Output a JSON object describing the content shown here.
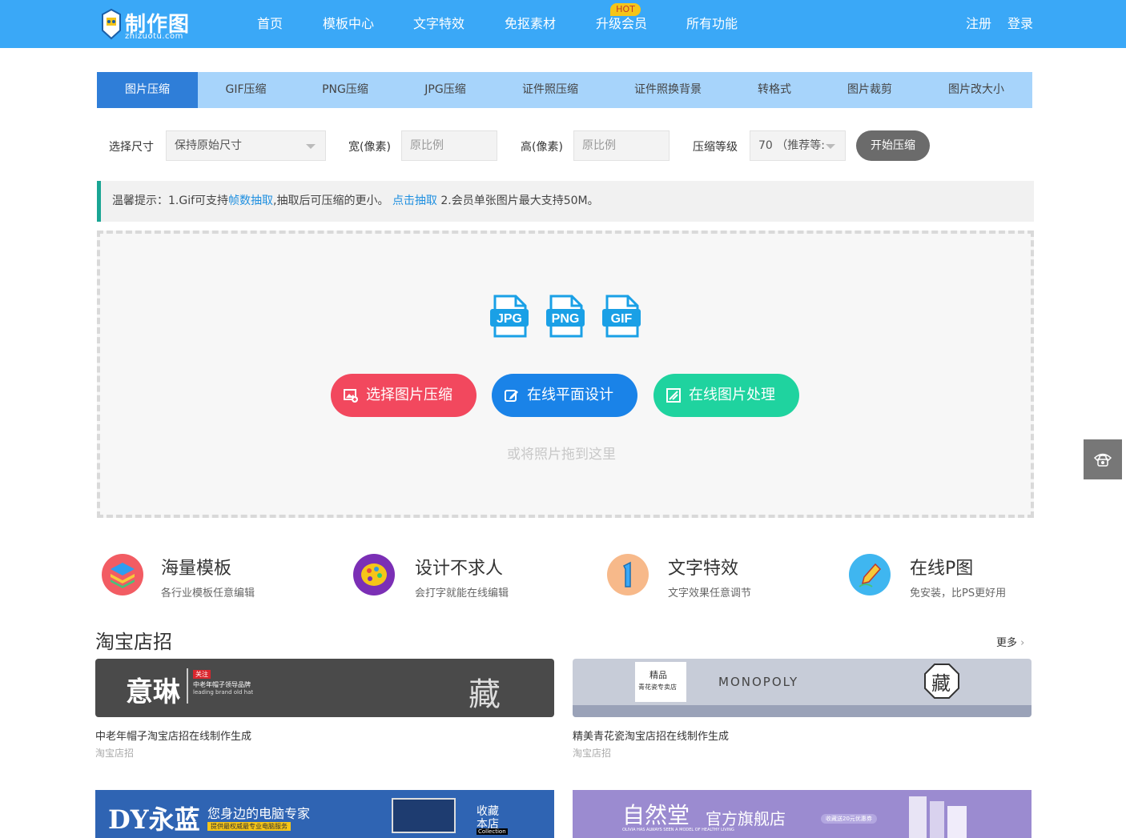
{
  "header": {
    "logo_text": "制作图",
    "logo_sub": "zhizuotu.com",
    "nav": [
      "首页",
      "模板中心",
      "文字特效",
      "免抠素材",
      "升级会员",
      "所有功能"
    ],
    "hot_badge": "HOT",
    "register": "注册",
    "login": "登录"
  },
  "tabs": [
    "图片压缩",
    "GIF压缩",
    "PNG压缩",
    "JPG压缩",
    "证件照压缩",
    "证件照换背景",
    "转格式",
    "图片裁剪",
    "图片改大小"
  ],
  "controls": {
    "size_label": "选择尺寸",
    "size_value": "保持原始尺寸",
    "width_label": "宽(像素)",
    "width_placeholder": "原比例",
    "height_label": "高(像素)",
    "height_placeholder": "原比例",
    "level_label": "压缩等级",
    "level_value": "70 （推荐等:",
    "start_button": "开始压缩"
  },
  "tip": {
    "prefix": "温馨提示：1.Gif可支持",
    "link1": "帧数抽取",
    "middle": ",抽取后可压缩的更小。 ",
    "link2": "点击抽取",
    "suffix": " 2.会员单张图片最大支持50M。"
  },
  "drop": {
    "file_types": [
      "JPG",
      "PNG",
      "GIF"
    ],
    "select_button": "选择图片压缩",
    "design_button": "在线平面设计",
    "process_button": "在线图片处理",
    "hint": "或将照片拖到这里"
  },
  "features": [
    {
      "title": "海量模板",
      "sub": "各行业模板任意编辑"
    },
    {
      "title": "设计不求人",
      "sub": "会打字就能在线编辑"
    },
    {
      "title": "文字特效",
      "sub": "文字效果任意调节"
    },
    {
      "title": "在线P图",
      "sub": "免安装，比PS更好用"
    }
  ],
  "section": {
    "title": "淘宝店招",
    "more": "更多",
    "cards": [
      {
        "title": "中老年帽子淘宝店招在线制作生成",
        "category": "淘宝店招",
        "banner_main": "意琳",
        "banner_follow": "关注",
        "banner_line1": "中老年帽子领导品牌",
        "banner_line2": "leading brand old hat",
        "banner_stamp": "藏"
      },
      {
        "title": "精美青花瓷淘宝店招在线制作生成",
        "category": "淘宝店招",
        "banner_brand": "MONOPOLY",
        "banner_box1": "精品",
        "banner_box2": "青花瓷专卖店",
        "banner_stamp": "藏"
      }
    ],
    "banners_row2": [
      {
        "main": "DY永蓝",
        "slogan": "您身边的电脑专家",
        "sub": "提供最权威最专业电脑服务",
        "side1": "收藏",
        "side2": "本店",
        "side3": "Collection"
      },
      {
        "main": "自然堂",
        "slogan": "官方旗舰店",
        "sub": "OLIVIA HAS ALWAYS SEEN A MODEL OF HEALTHY LIVING",
        "coupon": "收藏送20元优惠券"
      }
    ]
  },
  "colors": {
    "header": "#3aa8f7",
    "tab_active": "#2f7ed8",
    "tab_bar": "#a7d4fb",
    "btn_red": "#f2485e",
    "btn_blue": "#1a83e8",
    "btn_green": "#1fd39f",
    "file_icon": "#1aa0e6"
  }
}
